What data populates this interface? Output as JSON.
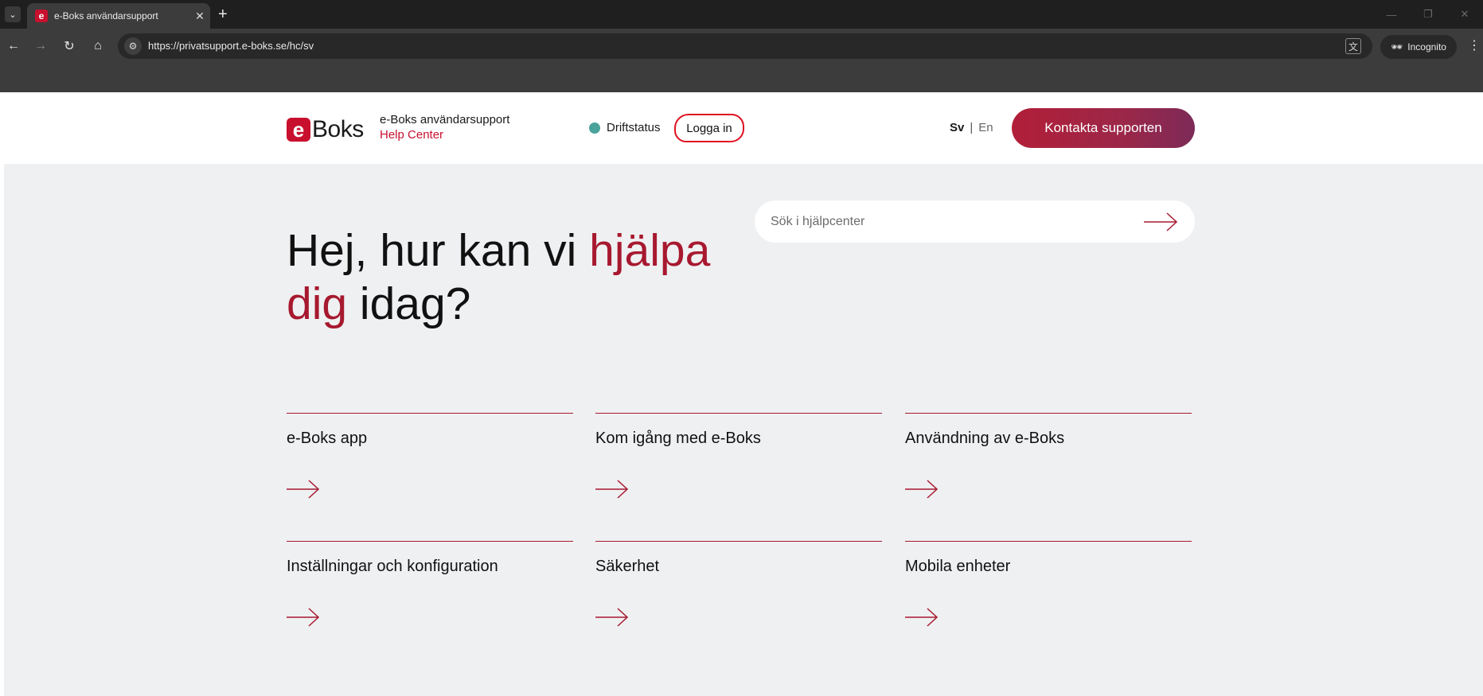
{
  "browser": {
    "tab_title": "e-Boks användarsupport",
    "url": "https://privatsupport.e-boks.se/hc/sv",
    "incognito_label": "Incognito",
    "favicon_letter": "e"
  },
  "header": {
    "logo_letter": "e",
    "logo_word": "Boks",
    "logo_line1": "e-Boks användarsupport",
    "logo_line2": "Help Center",
    "status_label": "Driftstatus",
    "login_label": "Logga in",
    "lang_sv": "Sv",
    "lang_separator": "|",
    "lang_en": "En",
    "contact_label": "Kontakta supporten"
  },
  "hero": {
    "title_part1": "Hej, hur kan vi ",
    "title_accent1": "hjälpa",
    "title_accent2": "dig",
    "title_part2": " idag?",
    "search_placeholder": "Sök i hjälpcenter"
  },
  "categories": [
    {
      "label": "e-Boks app"
    },
    {
      "label": "Kom igång med e-Boks"
    },
    {
      "label": "Användning av e-Boks"
    },
    {
      "label": "Inställningar och konfiguration"
    },
    {
      "label": "Säkerhet"
    },
    {
      "label": "Mobila enheter"
    }
  ],
  "colors": {
    "brand_red": "#c8102e",
    "accent": "#a7192f",
    "status_green": "#4aa39b"
  }
}
